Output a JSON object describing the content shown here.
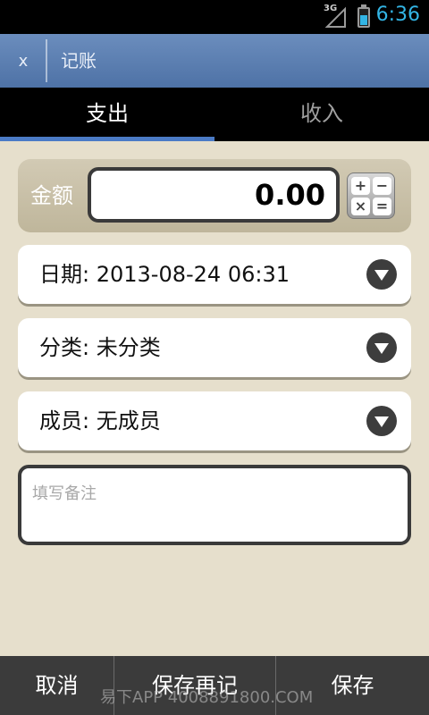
{
  "status_bar": {
    "network": "3G",
    "time": "6:36"
  },
  "title_bar": {
    "close_label": "x",
    "title": "记账"
  },
  "tabs": [
    {
      "label": "支出",
      "active": true
    },
    {
      "label": "收入",
      "active": false
    }
  ],
  "amount": {
    "label": "金额",
    "value": "0.00",
    "calc_keys": [
      "+",
      "−",
      "×",
      "="
    ]
  },
  "fields": {
    "date": "日期: 2013-08-24 06:31",
    "category": "分类: 未分类",
    "member": "成员: 无成员"
  },
  "notes": {
    "placeholder": "填写备注",
    "value": ""
  },
  "bottom_bar": {
    "cancel_label": "取消",
    "save_again_label": "保存再记",
    "save_label": "保存"
  },
  "watermark": "易下APP  4008891800.COM",
  "colors": {
    "title_bar": "#5a7db2",
    "tab_indicator": "#4b7bc6",
    "background": "#e6dfcc",
    "status_accent": "#33b5e5"
  }
}
